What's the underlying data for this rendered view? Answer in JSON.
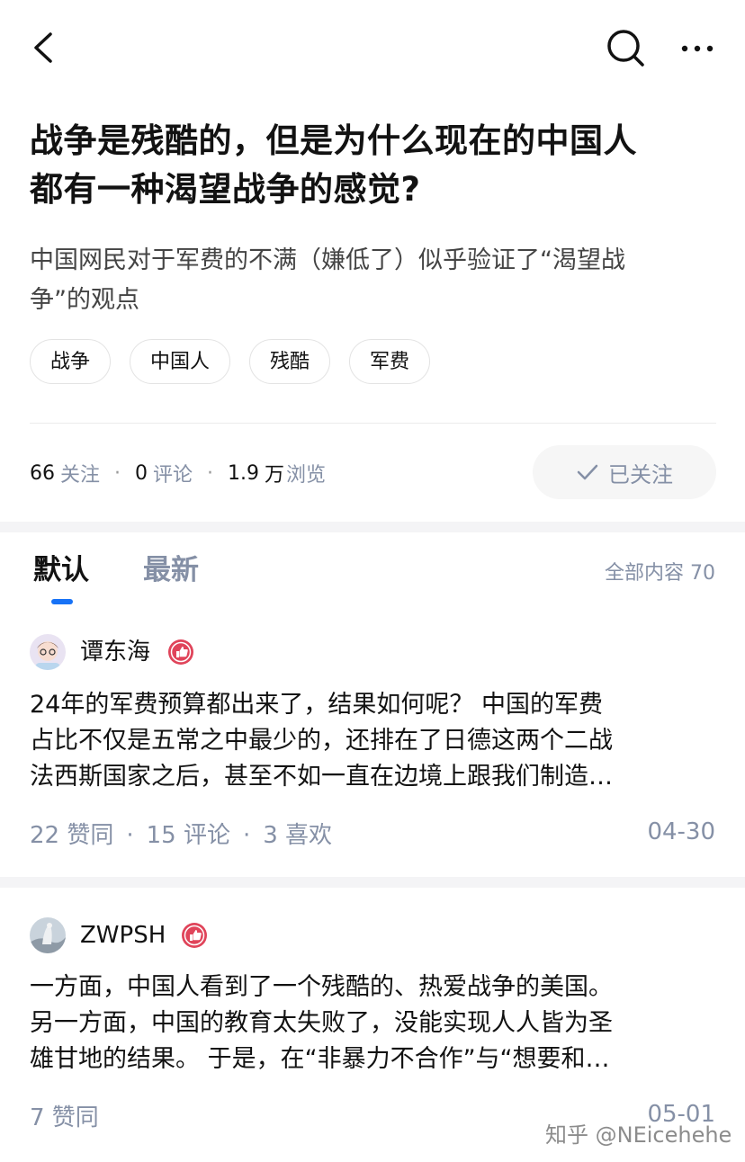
{
  "nav": {
    "back_icon": "chevron-left-icon",
    "search_icon": "search-icon",
    "more_icon": "more-horizontal-icon"
  },
  "question": {
    "title_line1": "战争是残酷的，但是为什么现在的中国人",
    "title_line2": "都有一种渴望战争的感觉?",
    "desc_line1": "中国网民对于军费的不满（嫌低了）似乎验证了“渴望战",
    "desc_line2": "争”的观点",
    "tags": [
      "战争",
      "中国人",
      "残酷",
      "军费"
    ]
  },
  "stats": {
    "followers_num": "66",
    "followers_label": "关注",
    "comments_num": "0",
    "comments_label": "评论",
    "views_num": "1.9",
    "views_unit": "万",
    "views_label": "浏览",
    "dot": "·"
  },
  "follow_button": {
    "label": "已关注",
    "icon": "check-icon"
  },
  "tabs": {
    "default": "默认",
    "latest": "最新",
    "total": "全部内容 70"
  },
  "answers": [
    {
      "author": "谭东海",
      "badge_icon": "thumb-up-badge-icon",
      "line1": "24年的军费预算都出来了，结果如何呢？ 中国的军费",
      "line2": "占比不仅是五常之中最少的，还排在了日德这两个二战",
      "line3": "法西斯国家之后，甚至不如一直在边境上跟我们制造…",
      "upvotes": "22 赞同",
      "comments": "15 评论",
      "likes": "3 喜欢",
      "date": "04-30"
    },
    {
      "author": "ZWPSH",
      "badge_icon": "thumb-up-badge-icon",
      "line1": "一方面，中国人看到了一个残酷的、热爱战争的美国。",
      "line2": "另一方面，中国的教育太失败了，没能实现人人皆为圣",
      "line3": "雄甘地的结果。 于是，在“非暴力不合作”与“想要和…",
      "upvotes": "7 赞同",
      "date": "05-01"
    }
  ],
  "watermark": "知乎 @NEicehehe",
  "colors": {
    "accent": "#1772f6",
    "badge": "#e0445a",
    "muted": "#8590a6"
  }
}
